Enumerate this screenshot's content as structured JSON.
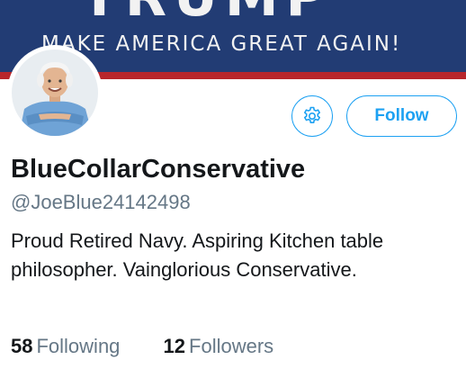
{
  "banner": {
    "top_text": "TRUMP",
    "slogan": "MAKE AMERICA GREAT AGAIN!",
    "background_color": "#223c74",
    "stripe_color": "#b8262c"
  },
  "profile": {
    "avatar_icon": "avatar-photo",
    "display_name": "BlueCollarConservative",
    "handle": "@JoeBlue24142498",
    "bio": "Proud Retired Navy. Aspiring Kitchen table philosopher. Vainglorious Conservative."
  },
  "actions": {
    "settings_icon": "gear-icon",
    "follow_label": "Follow",
    "accent_color": "#1da1f2"
  },
  "stats": {
    "following_count": "58",
    "following_label": "Following",
    "followers_count": "12",
    "followers_label": "Followers"
  }
}
